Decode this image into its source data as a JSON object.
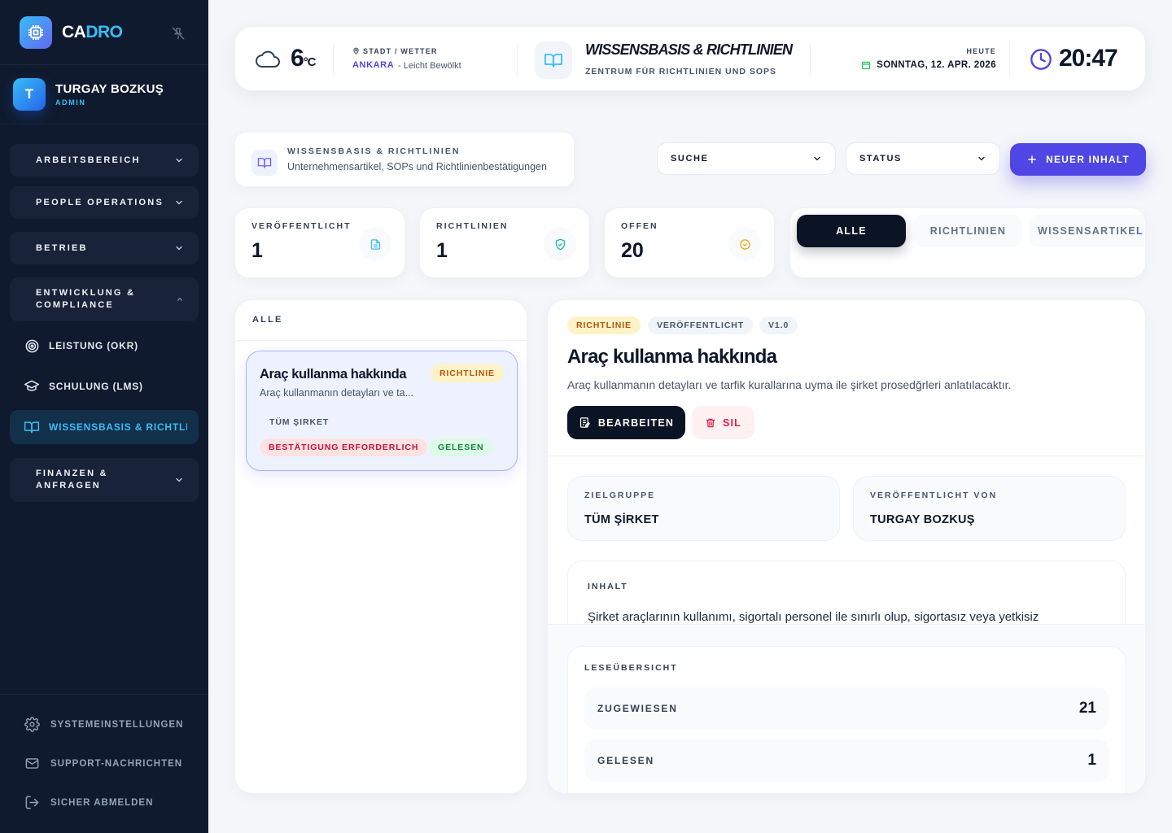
{
  "sidebar": {
    "brand": {
      "prefix": "CA",
      "accent": "DRO"
    },
    "user": {
      "initial": "T",
      "name": "TURGAY BOZKUŞ",
      "role": "ADMIN"
    },
    "groups": [
      {
        "label": "ARBEITSBEREICH",
        "expanded": false
      },
      {
        "label": "PEOPLE OPERATIONS",
        "expanded": false
      },
      {
        "label": "BETRIEB",
        "expanded": false
      },
      {
        "label": "ENTWICKLUNG & COMPLIANCE",
        "expanded": true
      },
      {
        "label": "FINANZEN & ANFRAGEN",
        "expanded": false
      }
    ],
    "sub_items": [
      {
        "label": "LEISTUNG (OKR)",
        "icon": "target-icon"
      },
      {
        "label": "SCHULUNG (LMS)",
        "icon": "graduation-cap-icon"
      },
      {
        "label": "WISSENSBASIS & RICHTLINIEN",
        "icon": "book-open-icon",
        "active": true
      }
    ],
    "footer": [
      {
        "label": "SYSTEMEINSTELLUNGEN",
        "icon": "gear-icon"
      },
      {
        "label": "SUPPORT-NACHRICHTEN",
        "icon": "mail-icon"
      },
      {
        "label": "SICHER ABMELDEN",
        "icon": "logout-icon"
      }
    ]
  },
  "topbar": {
    "weather": {
      "temp": "6",
      "unit": "°C",
      "location_label": "STADT / WETTER",
      "city": "ANKARA",
      "condition": "- Leicht Bewölkt"
    },
    "module": {
      "title": "WISSENSBASIS & RICHTLINIEN",
      "subtitle": "ZENTRUM FÜR RICHTLINIEN UND SOPS"
    },
    "date": {
      "label": "HEUTE",
      "value": "SONNTAG, 12. APR. 2026"
    },
    "time": "20:47"
  },
  "page_header": {
    "title": "WISSENSBASIS & RICHTLINIEN",
    "subtitle": "Unternehmensartikel, SOPs und Richtlinienbestätigungen"
  },
  "filters": {
    "search_label": "SUCHE",
    "status_label": "STATUS",
    "new_button": "NEUER INHALT"
  },
  "stats": [
    {
      "label": "VERÖFFENTLICHT",
      "value": "1",
      "icon": "document-icon",
      "color": "#38bdf8"
    },
    {
      "label": "RICHTLINIEN",
      "value": "1",
      "icon": "shield-check-icon",
      "color": "#14b8a6"
    },
    {
      "label": "OFFEN",
      "value": "20",
      "icon": "check-circle-icon",
      "color": "#f59e0b"
    }
  ],
  "tabs": [
    {
      "label": "ALLE",
      "active": true
    },
    {
      "label": "RICHTLINIEN",
      "active": false
    },
    {
      "label": "WISSENSARTIKEL",
      "active": false
    }
  ],
  "list": {
    "header": "ALLE",
    "items": [
      {
        "title": "Araç kullanma hakkında",
        "type_badge": "RICHTLINIE",
        "excerpt": "Araç kullanmanın detayları ve ta...",
        "audience": "TÜM ŞIRKET",
        "confirm_badge": "BESTÄTIGUNG ERFORDERLICH",
        "read_badge": "GELESEN"
      }
    ]
  },
  "detail": {
    "badges": [
      "RICHTLINIE",
      "VERÖFFENTLICHT",
      "V1.0"
    ],
    "title": "Araç kullanma hakkında",
    "description": "Araç kullanmanın detayları ve tarfik kurallarına uyma ile şirket prosedğrleri anlatılacaktır.",
    "edit_button": "BEARBEITEN",
    "delete_button": "SIL",
    "audience_label": "ZIELGRUPPE",
    "audience_value": "TÜM ŞİRKET",
    "published_by_label": "VERÖFFENTLICHT VON",
    "published_by_value": "TURGAY BOZKUŞ",
    "content_label": "INHALT",
    "content_text": "Şirket araçlarının kullanımı, sigortalı personel ile sınırlı olup, sigortasız veya yetkisiz",
    "reading_overview": {
      "label": "LESEÜBERSICHT",
      "rows": [
        {
          "key": "ZUGEWIESEN",
          "value": "21"
        },
        {
          "key": "GELESEN",
          "value": "1"
        }
      ]
    }
  },
  "colors": {
    "sidebar_bg": "#0f1a2e",
    "accent": "#38bdf8",
    "primary": "#4f46e5",
    "dark_button": "#0b1424"
  }
}
